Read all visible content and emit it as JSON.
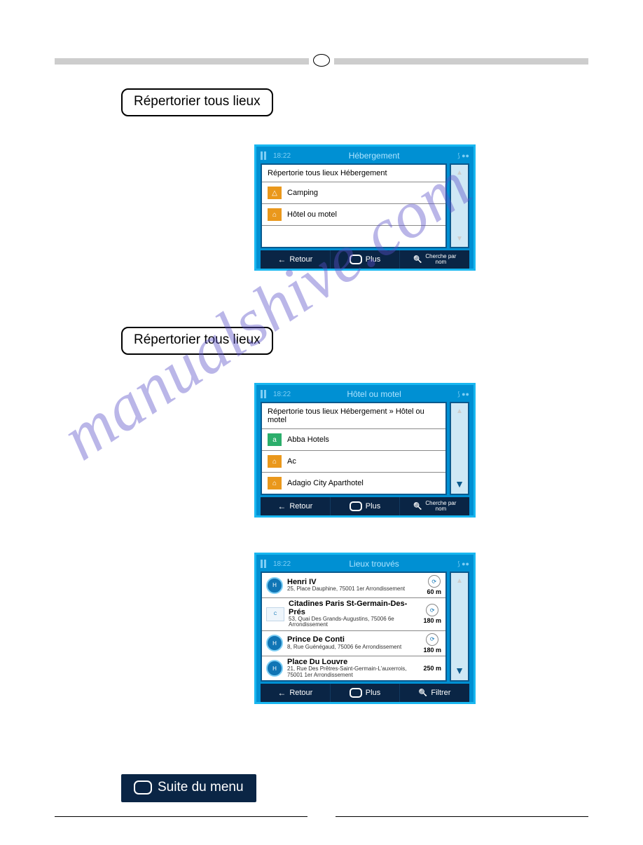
{
  "buttons": {
    "repertorier": "Répertorier tous lieux",
    "suite_menu": "Suite du menu"
  },
  "watermark": "manualshive.com",
  "devices": {
    "common": {
      "time": "18:22",
      "retour": "Retour",
      "plus": "Plus",
      "filtrer": "Filtrer",
      "cherche_par_nom_l1": "Cherche par",
      "cherche_par_nom_l2": "nom"
    },
    "d1": {
      "title": "Hébergement",
      "breadcrumb": "Répertorie tous lieux Hébergement",
      "row1": "Camping",
      "row2": "Hôtel ou motel"
    },
    "d2": {
      "title": "Hôtel ou motel",
      "breadcrumb": "Répertorie tous lieux Hébergement » Hôtel ou motel",
      "row1": "Abba Hotels",
      "row2": "Ac",
      "row3": "Adagio City Aparthotel"
    },
    "d3": {
      "title": "Lieux trouvés",
      "r1": {
        "t": "Henri IV",
        "s": "25, Place Dauphine, 75001 1er Arrondissement",
        "d": "60 m"
      },
      "r2": {
        "t": "Citadines Paris St-Germain-Des-Prés",
        "s": "53, Quai Des Grands-Augustins, 75006 6e Arrondissement",
        "d": "180 m"
      },
      "r3": {
        "t": "Prince De Conti",
        "s": "8, Rue Guénégaud, 75006 6e Arrondissement",
        "d": "180 m"
      },
      "r4": {
        "t": "Place Du Louvre",
        "s": "21, Rue Des Prêtres-Saint-Germain-L'auxerrois, 75001 1er Arrondissement",
        "d": "250 m"
      }
    }
  }
}
